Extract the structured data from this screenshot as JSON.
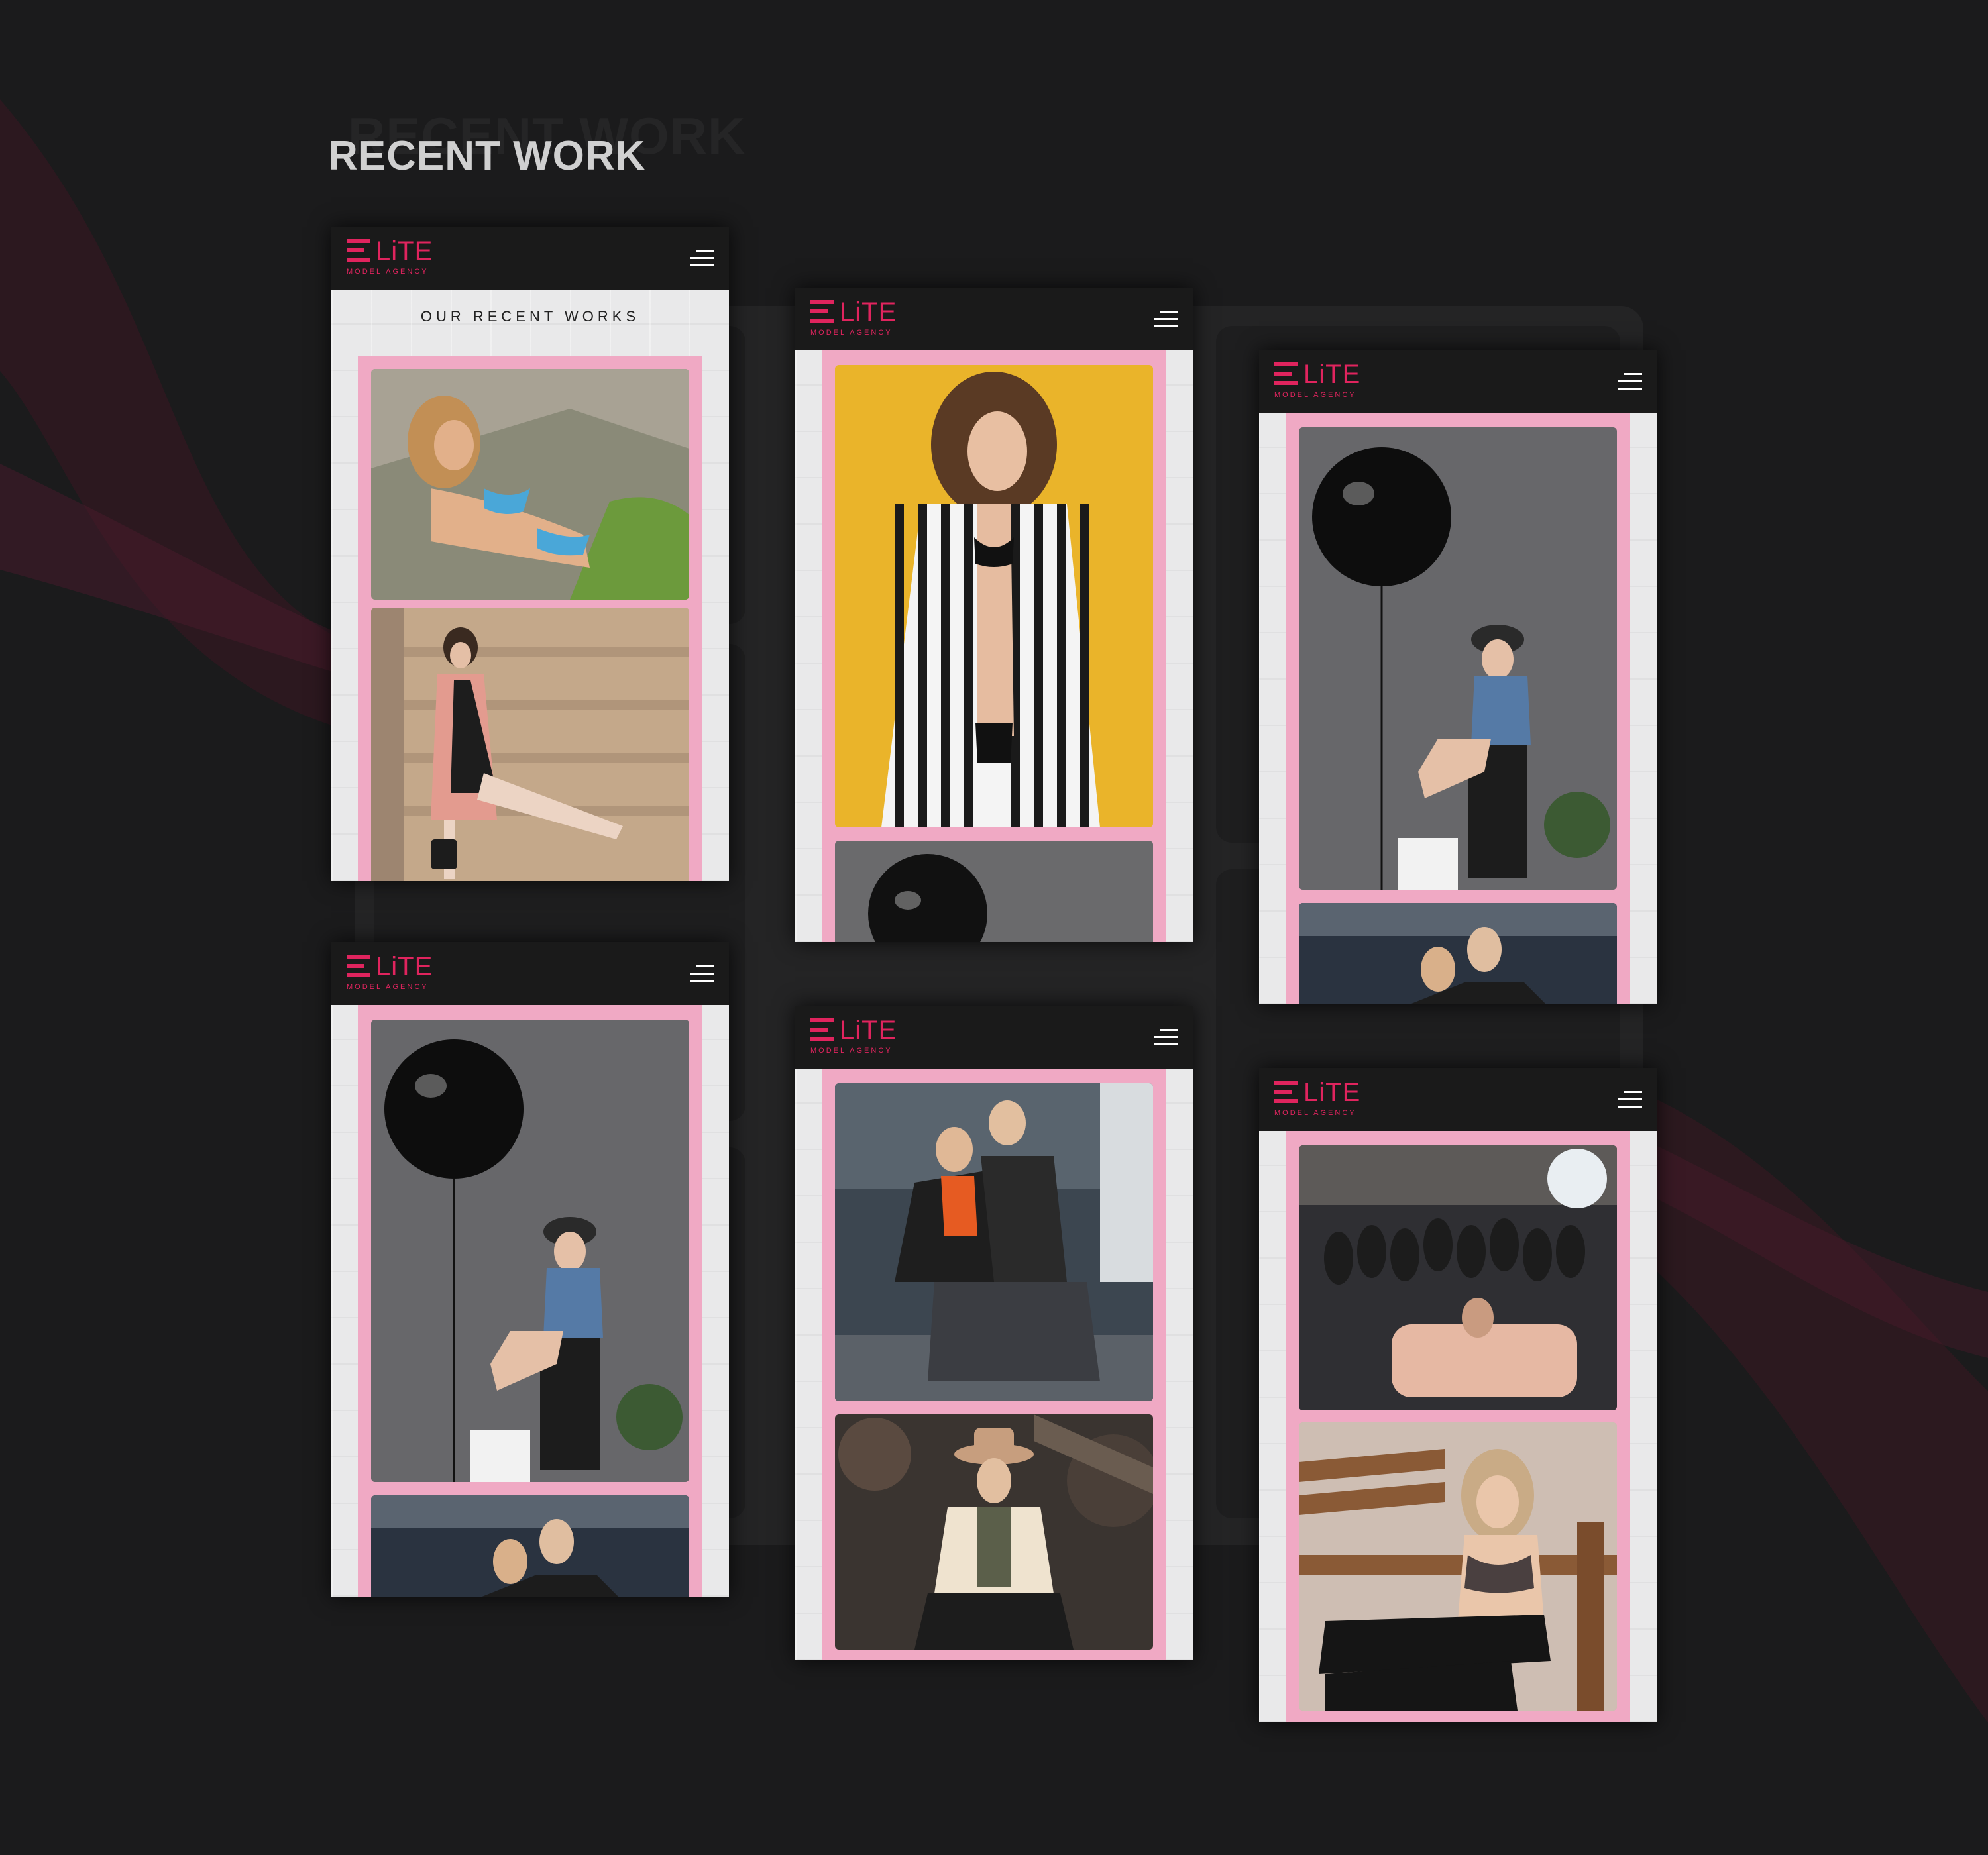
{
  "section": {
    "title": "RECENT WORK",
    "ghost_title": "RECENT WORK"
  },
  "brand": {
    "logo_text": "LiTE",
    "logo_sub": "MODEL AGENCY",
    "accent": "#e0245e",
    "panel_pink": "#f0a9c4",
    "header_bg": "#1a1a1a"
  },
  "icons": {
    "menu": "hamburger-menu-icon",
    "logo": "elite-logo-mark"
  },
  "phones": [
    {
      "heading": "OUR RECENT WORKS",
      "photos": [
        "woman in blue bikini on stone steps",
        "woman in pink coat kicking against wall"
      ]
    },
    {
      "heading": "",
      "photos": [
        "woman in striped shirt on yellow background",
        "black balloon on grey wall"
      ]
    },
    {
      "heading": "",
      "photos": [
        "woman with black balloon on chair",
        "couple posing in hall"
      ]
    },
    {
      "heading": "",
      "photos": [
        "woman with black balloon on chair",
        "couple posing in hall"
      ]
    },
    {
      "heading": "",
      "photos": [
        "couple sitting on steps",
        "man in hat among machinery"
      ]
    },
    {
      "heading": "",
      "photos": [
        "crowd at studio event",
        "woman sitting on wooden bench"
      ]
    }
  ]
}
